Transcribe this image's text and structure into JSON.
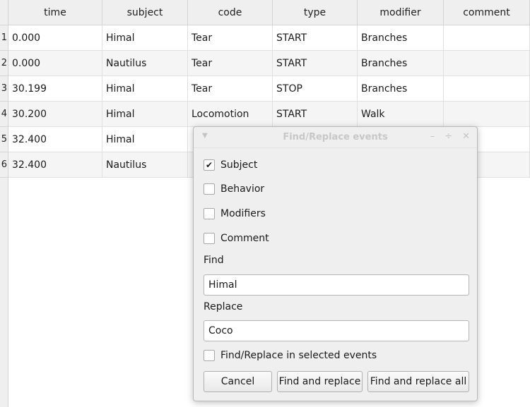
{
  "table": {
    "columns": [
      "time",
      "subject",
      "code",
      "type",
      "modifier",
      "comment"
    ],
    "row_numbers": [
      "1",
      "2",
      "3",
      "4",
      "5",
      "6"
    ],
    "rows": [
      {
        "time": "0.000",
        "subject": "Himal",
        "code": "Tear",
        "type": "START",
        "modifier": "Branches",
        "comment": ""
      },
      {
        "time": "0.000",
        "subject": "Nautilus",
        "code": "Tear",
        "type": "START",
        "modifier": "Branches",
        "comment": ""
      },
      {
        "time": "30.199",
        "subject": "Himal",
        "code": "Tear",
        "type": "STOP",
        "modifier": "Branches",
        "comment": ""
      },
      {
        "time": "30.200",
        "subject": "Himal",
        "code": "Locomotion",
        "type": "START",
        "modifier": "Walk",
        "comment": ""
      },
      {
        "time": "32.400",
        "subject": "Himal",
        "code": "",
        "type": "",
        "modifier": "",
        "comment": ""
      },
      {
        "time": "32.400",
        "subject": "Nautilus",
        "code": "",
        "type": "",
        "modifier": "",
        "comment": ""
      }
    ]
  },
  "dialog": {
    "title": "Find/Replace events",
    "menu_icon": "chevron-down-icon",
    "title_buttons": [
      "minimize-icon",
      "maximize-icon",
      "close-icon"
    ],
    "options": [
      {
        "label": "Subject",
        "checked": true
      },
      {
        "label": "Behavior",
        "checked": false
      },
      {
        "label": "Modifiers",
        "checked": false
      },
      {
        "label": "Comment",
        "checked": false
      }
    ],
    "find_label": "Find",
    "find_value": "Himal",
    "replace_label": "Replace",
    "replace_value": "Coco",
    "selected_events": {
      "label": "Find/Replace in selected events",
      "checked": false
    },
    "buttons": {
      "cancel": "Cancel",
      "find_and_replace": "Find and replace",
      "find_and_replace_all": "Find and replace all"
    }
  }
}
